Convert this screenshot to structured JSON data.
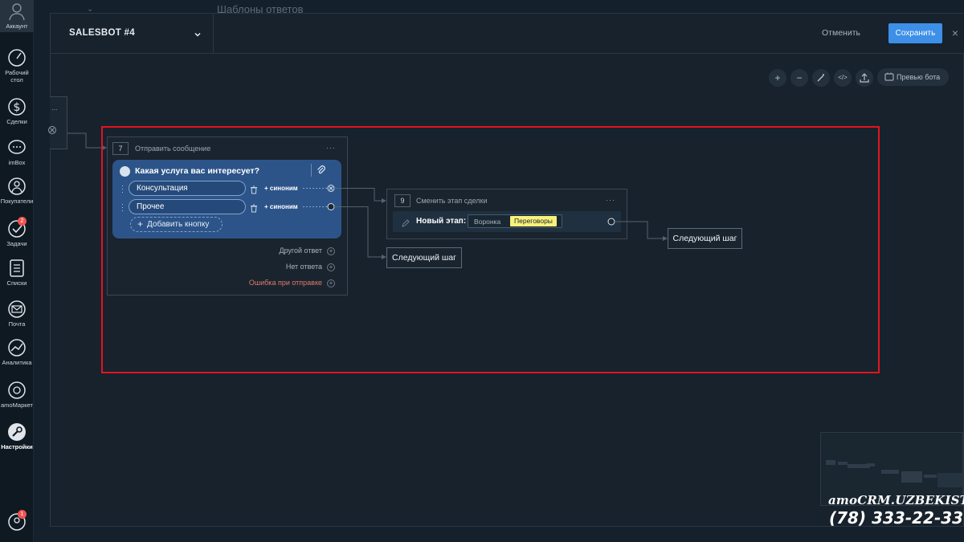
{
  "nav": {
    "items": [
      {
        "label": "Аккаунт"
      },
      {
        "label": "Рабочий стол"
      },
      {
        "label": "Сделки"
      },
      {
        "label": "imBox"
      },
      {
        "label": "Покупатели"
      },
      {
        "label": "Задачи",
        "badge": "2"
      },
      {
        "label": "Списки"
      },
      {
        "label": "Почта"
      },
      {
        "label": "Аналитика"
      },
      {
        "label": "amoМаркет"
      },
      {
        "label": "Настройки"
      },
      {
        "badge": "1"
      }
    ]
  },
  "background": {
    "title": "Шаблоны ответов"
  },
  "header": {
    "bot_name": "SALESBOT #4",
    "cancel_label": "Отменить",
    "save_label": "Сохранить",
    "close_glyph": "×"
  },
  "toolbar": {
    "zoom_in": "+",
    "zoom_out": "−",
    "code": "</>",
    "preview_label": "Превью бота"
  },
  "fragment": {
    "dots": "..."
  },
  "block_send": {
    "number": "7",
    "title": "Отправить сообщение",
    "menu": "···",
    "question": "Какая услуга вас интересует?",
    "options": [
      {
        "label": "Консультация",
        "synonym": "+ синоним"
      },
      {
        "label": "Прочее",
        "synonym": "+ синоним"
      }
    ],
    "add_button_label": "Добавить кнопку",
    "add_plus": "+",
    "other_answer": "Другой ответ",
    "no_answer": "Нет ответа",
    "send_error": "Ошибка при отправке"
  },
  "block_stage": {
    "number": "9",
    "title": "Сменить этап сделки",
    "menu": "···",
    "new_stage_label": "Новый этап:",
    "funnel_label": "Воронка",
    "stage_value": "Переговоры",
    "stage_chip_color": "#f8f27b"
  },
  "next_steps": [
    "Следующий шаг",
    "Следующий шаг"
  ],
  "watermark": {
    "brand": "amoCRM.UZBEKISTAN",
    "phone": "(78) 333-22-33"
  },
  "colors": {
    "accent": "#3d8fe8",
    "highlight": "#e3141f",
    "message_card": "#2c5489"
  }
}
